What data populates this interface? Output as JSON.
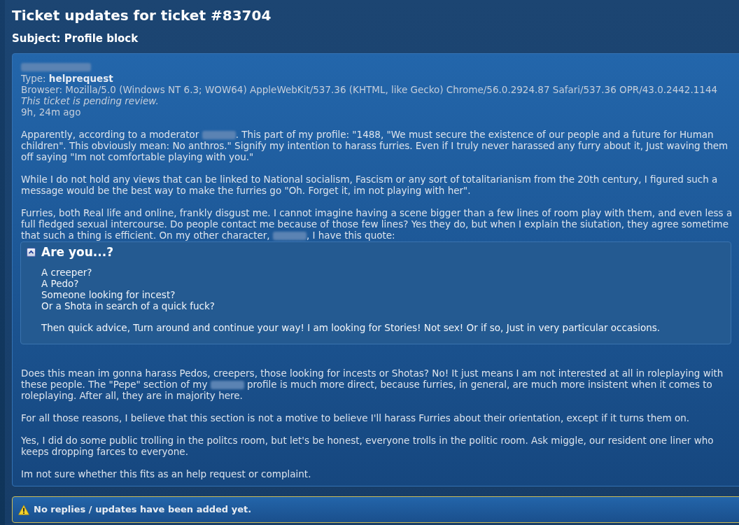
{
  "page": {
    "title": "Ticket updates for ticket #83704",
    "subject": "Subject: Profile block"
  },
  "ticket": {
    "meta": [
      {
        "kind": "redacted"
      },
      {
        "kind": "plain",
        "text": "Type: **helprequest**"
      },
      {
        "kind": "plain",
        "text": "Browser: Mozilla/5.0 (Windows NT 6.3; WOW64) AppleWebKit/537.36 (KHTML, like Gecko) Chrome/56.0.2924.87 Safari/537.36 OPR/43.0.2442.1144"
      },
      {
        "kind": "status",
        "text": "This ticket is pending review."
      },
      {
        "kind": "plain",
        "text": "9h, 24m ago"
      }
    ],
    "body": [
      {
        "kind": "paragraph",
        "segments": [
          {
            "kind": "text",
            "text": "Apparently, according to a moderator "
          },
          {
            "kind": "redacted"
          },
          {
            "kind": "text",
            "text": ". This part of my profile: \"1488, \"We must secure the existence of our people and a future for Human children\". This obviously mean: No anthros.\" Signify my intention to harass furries. Even if I truly never harassed any furry about it, Just waving them off saying \"Im not comfortable playing with you.\""
          }
        ]
      },
      {
        "kind": "paragraph",
        "segments": [
          {
            "kind": "text",
            "text": "While I do not hold any views that can be linked to National socialism, Fascism or any sort of totalitarianism from the 20th century, I figured such a message would be the best way to make the furries go \"Oh. Forget it, im not playing with her\"."
          }
        ]
      },
      {
        "kind": "paragraph",
        "segments": [
          {
            "kind": "text",
            "text": "Furries, both Real life and online, frankly disgust me. I cannot imagine having a scene bigger than a few lines of room play with them, and even less a full fledged sexual intercourse. Do people contact me because of those few lines? Yes they do, but when I explain the siutation, they agree sometime that such a thing is efficient. On my other character, "
          },
          {
            "kind": "redacted"
          },
          {
            "kind": "text",
            "text": ", I have this quote:"
          }
        ]
      },
      {
        "kind": "spoiler",
        "title": "Are you...?",
        "expanded": true,
        "lines": [
          "A creeper?",
          "A Pedo?",
          "Someone looking for incest?",
          "Or a Shota in search of a quick fuck?"
        ],
        "closing": "Then quick advice, Turn around and continue your way! I am looking for Stories! Not sex! Or if so, Just in very particular occasions."
      },
      {
        "kind": "paragraph",
        "segments": [
          {
            "kind": "text",
            "text": "Does this mean im gonna harass Pedos, creepers, those looking for incests or Shotas? No! It just means I am not interested at all in roleplaying with these people. The \"Pepe\" section of my "
          },
          {
            "kind": "redacted"
          },
          {
            "kind": "text",
            "text": " profile is much more direct, because furries, in general, are much more insistent when it comes to roleplaying. After all, they are in majority here."
          }
        ]
      },
      {
        "kind": "paragraph",
        "segments": [
          {
            "kind": "text",
            "text": "For all those reasons, I believe that this section is not a motive to believe I'll harass Furries about their orientation, except if it turns them on."
          }
        ]
      },
      {
        "kind": "paragraph",
        "segments": [
          {
            "kind": "text",
            "text": "Yes, I did do some public trolling in the politcs room, but let's be honest, everyone trolls in the politic room. Ask miggle, our resident one liner who keeps dropping farces to everyone."
          }
        ]
      },
      {
        "kind": "paragraph",
        "segments": [
          {
            "kind": "text",
            "text": "Im not sure whether this fits as an help request or complaint."
          }
        ]
      }
    ]
  },
  "notice": {
    "kind": "warning",
    "text": "No replies / updates have been added yet."
  }
}
